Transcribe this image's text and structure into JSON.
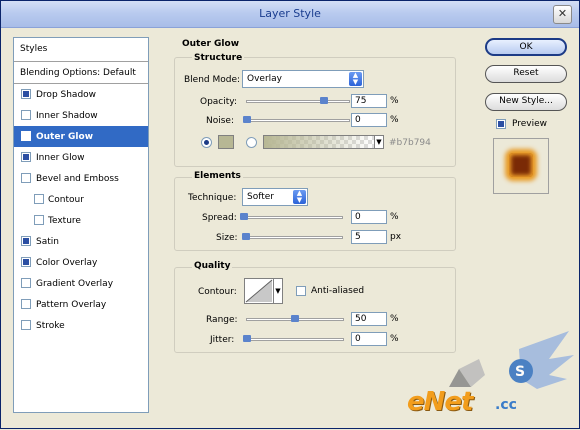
{
  "window": {
    "title": "Layer Style",
    "close_glyph": "✕"
  },
  "styles_panel": {
    "header": "Styles",
    "blending_options": "Blending Options: Default",
    "items": [
      {
        "label": "Drop Shadow",
        "checked": true,
        "selected": false,
        "sub": false
      },
      {
        "label": "Inner Shadow",
        "checked": false,
        "selected": false,
        "sub": false
      },
      {
        "label": "Outer Glow",
        "checked": true,
        "selected": true,
        "sub": false
      },
      {
        "label": "Inner Glow",
        "checked": true,
        "selected": false,
        "sub": false
      },
      {
        "label": "Bevel and Emboss",
        "checked": false,
        "selected": false,
        "sub": false
      },
      {
        "label": "Contour",
        "checked": false,
        "selected": false,
        "sub": true
      },
      {
        "label": "Texture",
        "checked": false,
        "selected": false,
        "sub": true
      },
      {
        "label": "Satin",
        "checked": true,
        "selected": false,
        "sub": false
      },
      {
        "label": "Color Overlay",
        "checked": true,
        "selected": false,
        "sub": false
      },
      {
        "label": "Gradient Overlay",
        "checked": false,
        "selected": false,
        "sub": false
      },
      {
        "label": "Pattern Overlay",
        "checked": false,
        "selected": false,
        "sub": false
      },
      {
        "label": "Stroke",
        "checked": false,
        "selected": false,
        "sub": false
      }
    ]
  },
  "outer_glow": {
    "title": "Outer Glow",
    "structure": {
      "title": "Structure",
      "blend_mode_label": "Blend Mode:",
      "blend_mode_value": "Overlay",
      "opacity_label": "Opacity:",
      "opacity_value": "75",
      "opacity_fraction": 0.75,
      "opacity_unit": "%",
      "noise_label": "Noise:",
      "noise_value": "0",
      "noise_fraction": 0,
      "noise_unit": "%",
      "color_hex": "#b7b794",
      "color_swatch": "#b7b794"
    },
    "elements": {
      "title": "Elements",
      "technique_label": "Technique:",
      "technique_value": "Softer",
      "spread_label": "Spread:",
      "spread_value": "0",
      "spread_fraction": 0,
      "spread_unit": "%",
      "size_label": "Size:",
      "size_value": "5",
      "size_fraction": 0.02,
      "size_unit": "px"
    },
    "quality": {
      "title": "Quality",
      "contour_label": "Contour:",
      "anti_aliased_label": "Anti-aliased",
      "anti_aliased_checked": false,
      "range_label": "Range:",
      "range_value": "50",
      "range_fraction": 0.5,
      "range_unit": "%",
      "jitter_label": "Jitter:",
      "jitter_value": "0",
      "jitter_fraction": 0,
      "jitter_unit": "%"
    }
  },
  "buttons": {
    "ok": "OK",
    "reset": "Reset",
    "new_style": "New Style...",
    "preview_label": "Preview",
    "preview_checked": true
  },
  "watermark": {
    "text": "eNet",
    "text2": ".cc"
  },
  "colors": {
    "accent": "#316ac5",
    "glow": "#e89a24"
  }
}
